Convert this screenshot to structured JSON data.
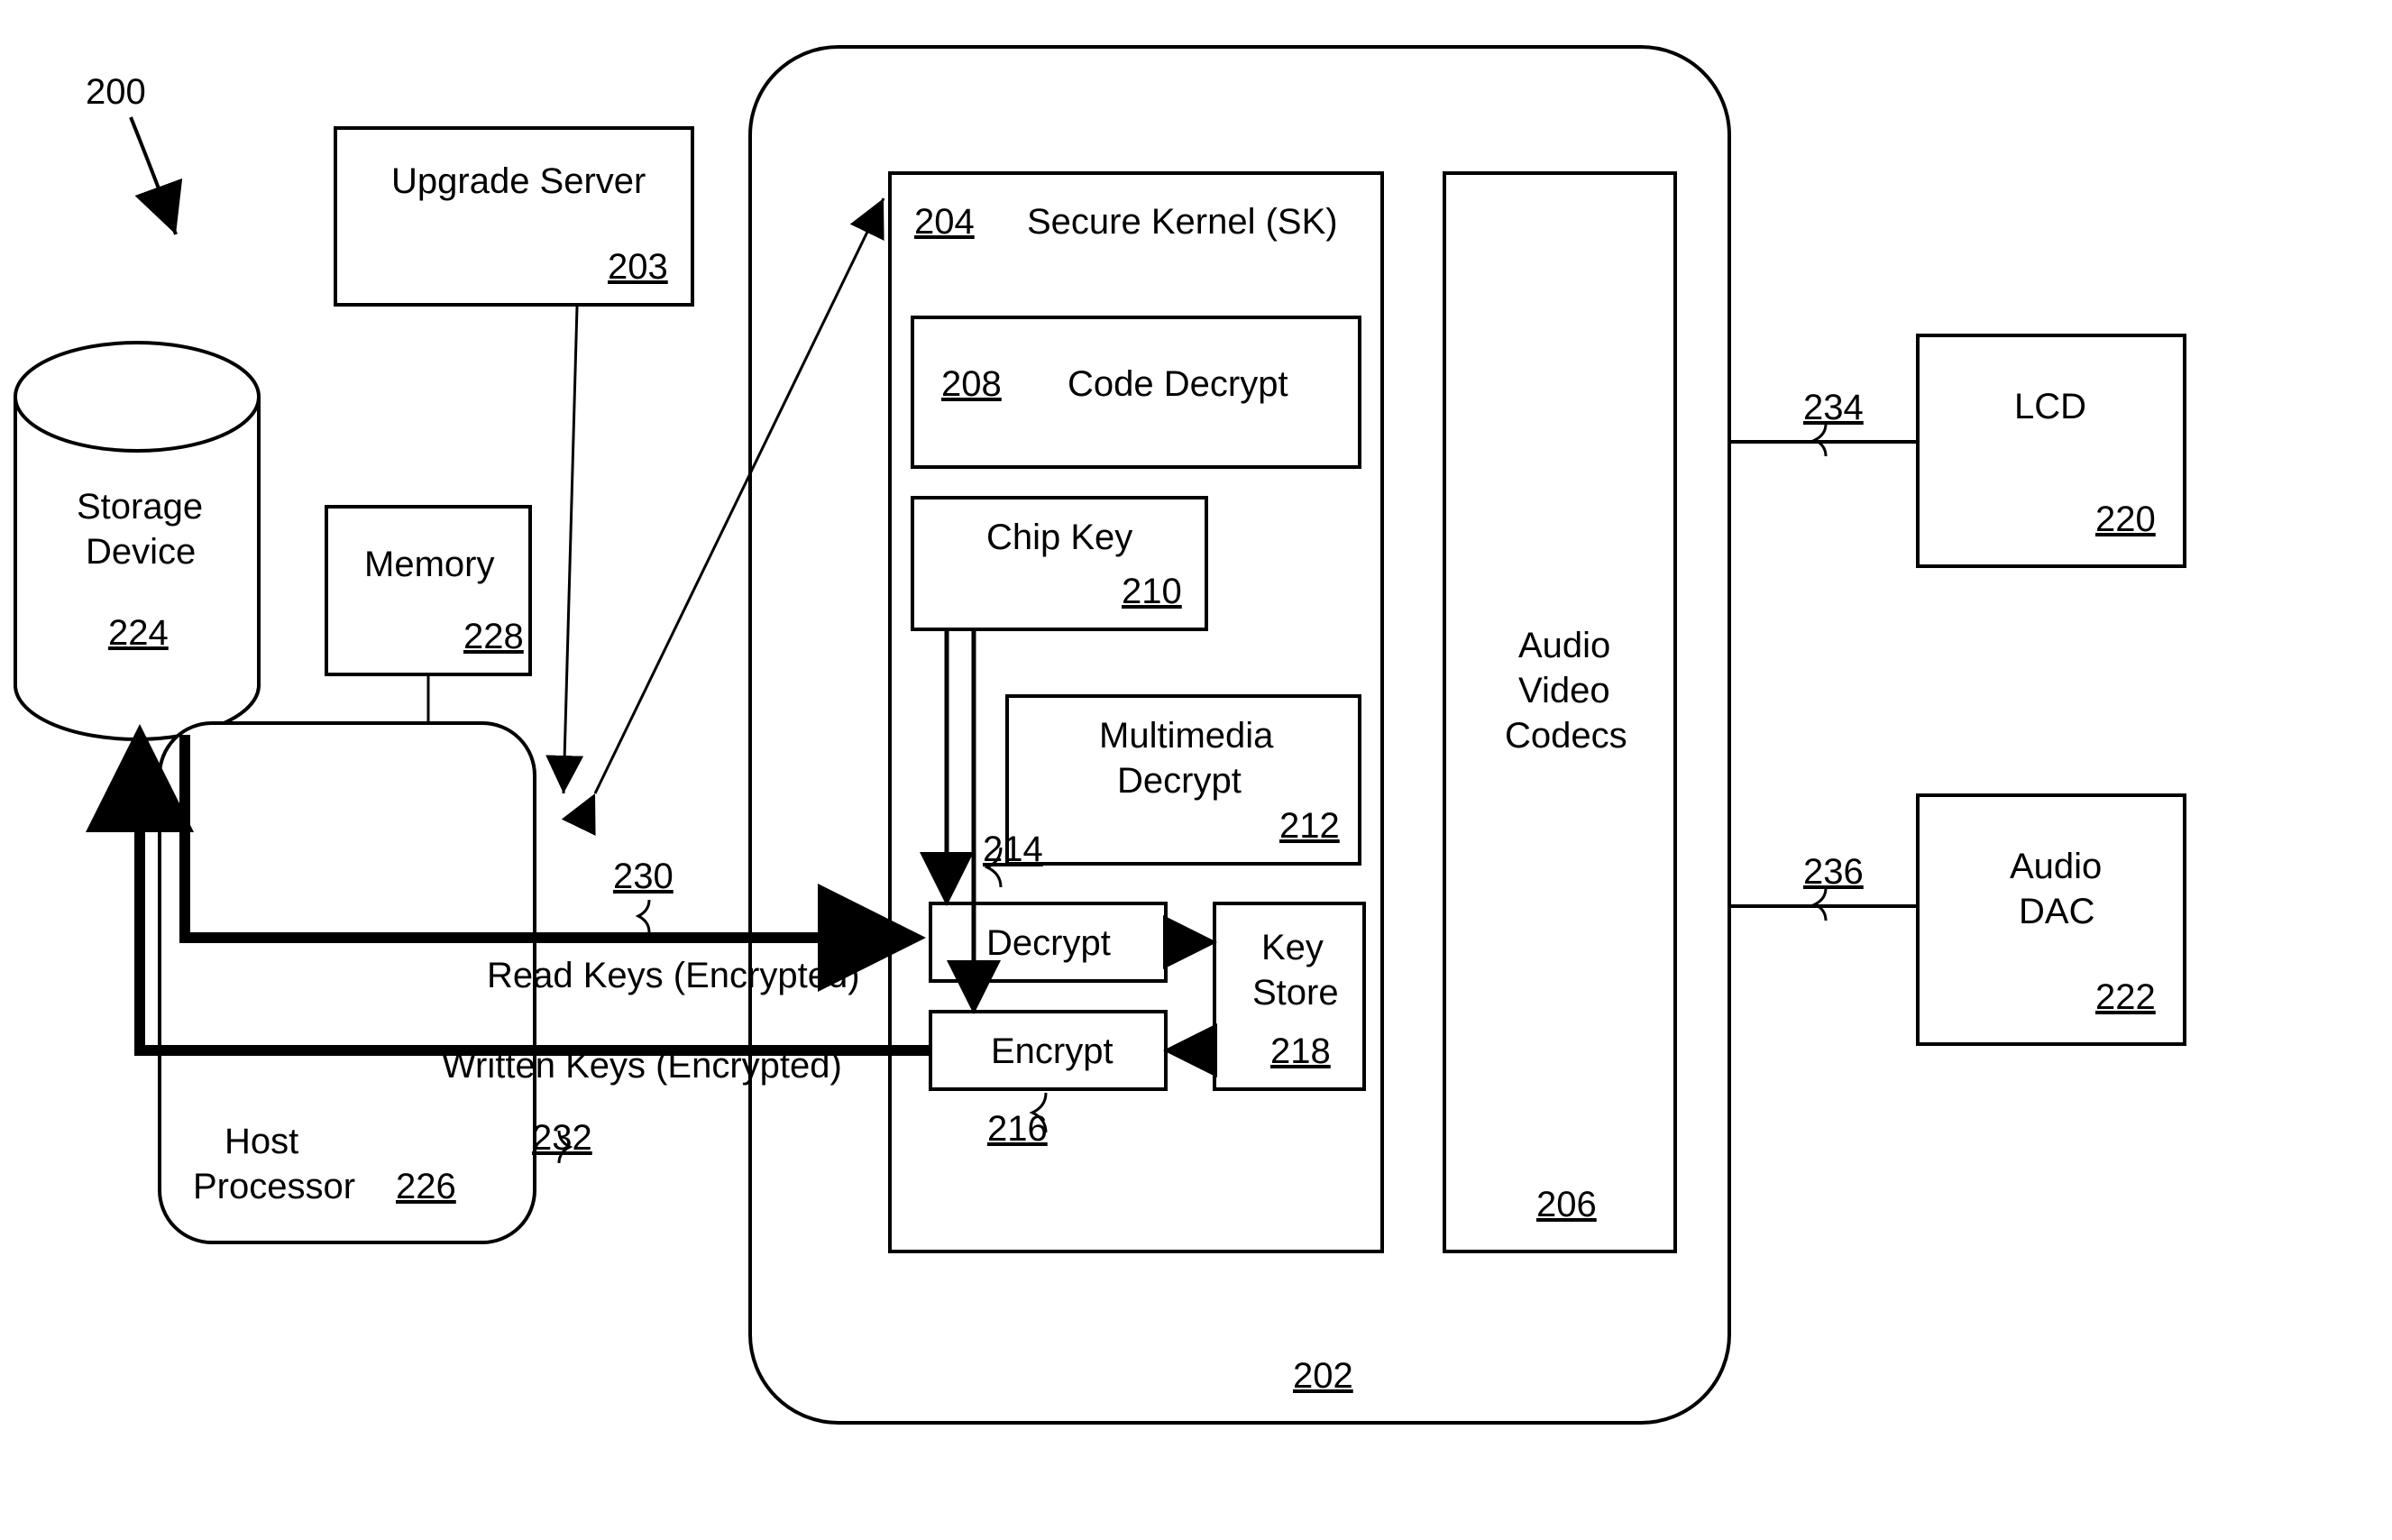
{
  "figure_ref": "200",
  "blocks": {
    "upgrade_server": {
      "label": "Upgrade Server",
      "ref": "203"
    },
    "storage_device": {
      "label1": "Storage",
      "label2": "Device",
      "ref": "224"
    },
    "memory": {
      "label": "Memory",
      "ref": "228"
    },
    "host_processor": {
      "label1": "Host",
      "label2": "Processor",
      "ref": "226"
    },
    "soc": {
      "ref": "202"
    },
    "secure_kernel": {
      "label": "Secure Kernel (SK)",
      "ref": "204"
    },
    "code_decrypt": {
      "label": "Code Decrypt",
      "ref": "208"
    },
    "chip_key": {
      "label": "Chip Key",
      "ref": "210"
    },
    "multimedia_decrypt": {
      "label1": "Multimedia",
      "label2": "Decrypt",
      "ref": "212"
    },
    "decrypt": {
      "label": "Decrypt",
      "ref": "214"
    },
    "encrypt": {
      "label": "Encrypt",
      "ref": "216"
    },
    "key_store": {
      "label1": "Key",
      "label2": "Store",
      "ref": "218"
    },
    "av_codecs": {
      "label1": "Audio",
      "label2": "Video",
      "label3": "Codecs",
      "ref": "206"
    },
    "lcd": {
      "label": "LCD",
      "ref": "220"
    },
    "audio_dac": {
      "label1": "Audio",
      "label2": "DAC",
      "ref": "222"
    }
  },
  "flows": {
    "read_keys": {
      "label": "Read Keys (Encrypted)",
      "ref": "230"
    },
    "written_keys": {
      "label": "Written Keys (Encrypted)",
      "ref": "232"
    },
    "to_lcd": {
      "ref": "234"
    },
    "to_dac": {
      "ref": "236"
    }
  }
}
